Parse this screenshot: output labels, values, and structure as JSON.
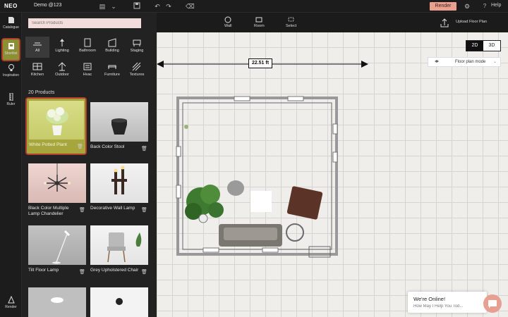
{
  "app": {
    "logo": "NEO",
    "project": "Demo @123",
    "render_label": "Render",
    "help_label": "Help"
  },
  "rail": {
    "items": [
      {
        "label": "Catalogue"
      },
      {
        "label": "Shortlist"
      },
      {
        "label": "Inspiration"
      },
      {
        "label": "Ruler"
      },
      {
        "label": "Render"
      }
    ]
  },
  "panel": {
    "search_placeholder": "Search Products",
    "categories": [
      {
        "label": "All"
      },
      {
        "label": "Lighting"
      },
      {
        "label": "Bathroom"
      },
      {
        "label": "Building"
      },
      {
        "label": "Staging"
      },
      {
        "label": "Kitchen"
      },
      {
        "label": "Outdoor"
      },
      {
        "label": "Hvac"
      },
      {
        "label": "Furniture"
      },
      {
        "label": "Textures"
      }
    ],
    "count_label": "20 Products",
    "products": [
      {
        "name": "White Potted Plant"
      },
      {
        "name": "Back Color Stool"
      },
      {
        "name": "Black Color Multiple Lamp Chandelier"
      },
      {
        "name": "Decorative Wall Lamp"
      },
      {
        "name": "Tilt Floor Lamp"
      },
      {
        "name": "Grey Upholstered Chair"
      }
    ]
  },
  "toolbar": {
    "wall": "Wall",
    "room": "Room",
    "select": "Select",
    "upload": "Upload Floor Plan"
  },
  "view": {
    "two_d": "2D",
    "three_d": "3D",
    "mode": "Floor plan mode"
  },
  "plan": {
    "dimension": "22.51 ft"
  },
  "chat": {
    "title": "We're Online!",
    "subtitle": "How May I Help You Tod..."
  },
  "colors": {
    "accent": "#e9a08e",
    "selected": "#a6a63c",
    "highlight_border": "#b0402b"
  }
}
